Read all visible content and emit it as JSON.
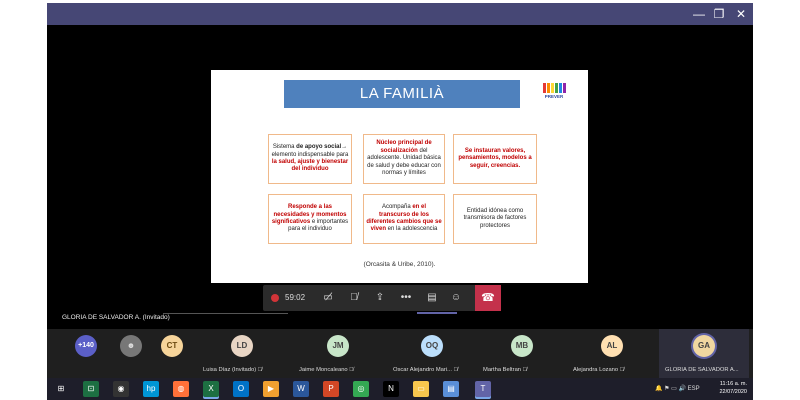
{
  "window": {
    "minimize": "—",
    "restore": "❐",
    "close": "✕"
  },
  "slide": {
    "title": "LA FAMILIÀ",
    "logo_text": "PREVER",
    "logo_colors": [
      "#e53935",
      "#fb8c00",
      "#fdd835",
      "#43a047",
      "#1e88e5",
      "#8e24aa"
    ],
    "cells": [
      [
        {
          "text": "Sistema ",
          "class": ""
        },
        {
          "text": "de apoyo social→",
          "class": "b"
        },
        {
          "text": " elemento indispensable para ",
          "class": ""
        },
        {
          "text": "la salud, ajuste y bienestar del individuo",
          "class": "red"
        }
      ],
      [
        {
          "text": "Núcleo principal de socialización",
          "class": "red"
        },
        {
          "text": " del adolescente. Unidad básica de salud y debe educar con normas y límites",
          "class": ""
        }
      ],
      [
        {
          "text": "Se instauran valores, pensamientos, modelos a seguir, creencias.",
          "class": "red"
        }
      ],
      [
        {
          "text": "Responde a las necesidades y momentos significativos",
          "class": "red"
        },
        {
          "text": " e importantes para el individuo",
          "class": ""
        }
      ],
      [
        {
          "text": "Acompaña ",
          "class": ""
        },
        {
          "text": "en el transcurso de los diferentes cambios que se viven",
          "class": "red"
        },
        {
          "text": " en la adolescencia",
          "class": ""
        }
      ],
      [
        {
          "text": "Entidad idónea como transmisora de factores protectores",
          "class": ""
        }
      ]
    ],
    "citation": "(Orcasita & Uribe, 2010)."
  },
  "controls": {
    "timer": "59:02"
  },
  "presenter": {
    "label": "GLORIA DE SALVADOR A. (Invitado)"
  },
  "participants": {
    "more_count": "+140",
    "ct_initials": "CT",
    "items": [
      {
        "initials": "LD",
        "name": "Luisa Díaz (Invitado) 🎙̸",
        "color": "#e8d5c4"
      },
      {
        "initials": "JM",
        "name": "Jaime Moncaleano 🎙̸",
        "color": "#c8e6c9"
      },
      {
        "initials": "OQ",
        "name": "Oscar Alejandro Mari... 🎙̸",
        "color": "#bbdefb"
      },
      {
        "initials": "MB",
        "name": "Martha Beltran 🎙̸",
        "color": "#c8e6c9"
      },
      {
        "initials": "AL",
        "name": "Alejandra Lozano 🎙̸",
        "color": "#ffe0b2"
      },
      {
        "initials": "GA",
        "name": "GLORIA DE SALVADOR A...",
        "color": "#f0d7a0"
      }
    ]
  },
  "taskbar": {
    "icons": [
      {
        "name": "windows-start-icon",
        "glyph": "⊞",
        "bg": "transparent"
      },
      {
        "name": "excel-online-icon",
        "glyph": "⊡",
        "bg": "#1d6f42"
      },
      {
        "name": "webcam-app-icon",
        "glyph": "◉",
        "bg": "#333"
      },
      {
        "name": "hp-icon",
        "glyph": "hp",
        "bg": "#0096d6"
      },
      {
        "name": "firefox-icon",
        "glyph": "◍",
        "bg": "#ff7139"
      },
      {
        "name": "excel-icon",
        "glyph": "X",
        "bg": "#1d6f42"
      },
      {
        "name": "outlook-icon",
        "glyph": "O",
        "bg": "#0072c6"
      },
      {
        "name": "media-player-icon",
        "glyph": "▶",
        "bg": "#f0a030"
      },
      {
        "name": "word-icon",
        "glyph": "W",
        "bg": "#2b579a"
      },
      {
        "name": "powerpoint-icon",
        "glyph": "P",
        "bg": "#d24726"
      },
      {
        "name": "chrome-icon",
        "glyph": "◎",
        "bg": "#34a853"
      },
      {
        "name": "netflix-icon",
        "glyph": "N",
        "bg": "#000"
      },
      {
        "name": "file-explorer-icon",
        "glyph": "▭",
        "bg": "#f8c74e"
      },
      {
        "name": "explorer-window-icon",
        "glyph": "▤",
        "bg": "#5a8fd8"
      },
      {
        "name": "teams-icon",
        "glyph": "T",
        "bg": "#6264a7"
      }
    ],
    "tray": "🔔 ⚑ ▭ 🔊 ESP",
    "time": "11:16 a. m.",
    "date": "22/07/2020"
  }
}
